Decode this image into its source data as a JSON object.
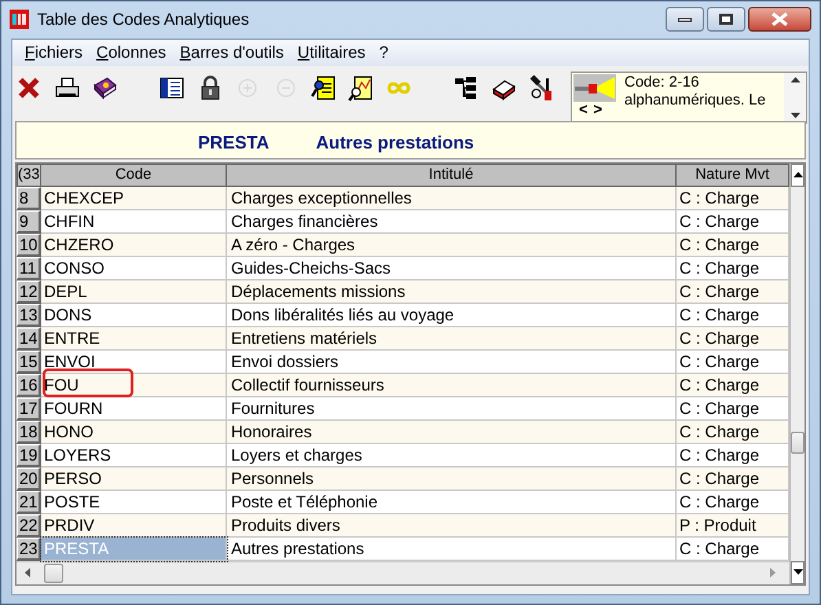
{
  "window": {
    "title": "Table des Codes Analytiques"
  },
  "menu": [
    {
      "label": "Fichiers",
      "underline_first": true
    },
    {
      "label": "Colonnes",
      "underline_first": true
    },
    {
      "label": "Barres d'outils",
      "underline_first": true
    },
    {
      "label": "Utilitaires",
      "underline_first": true
    },
    {
      "label": "?",
      "underline_first": false
    }
  ],
  "toolbar": [
    {
      "kind": "close",
      "disabled": false
    },
    {
      "kind": "print",
      "disabled": false
    },
    {
      "kind": "book",
      "disabled": false
    },
    {
      "kind": "gap"
    },
    {
      "kind": "list",
      "disabled": false
    },
    {
      "kind": "lock",
      "disabled": false
    },
    {
      "kind": "plus",
      "disabled": true
    },
    {
      "kind": "minus",
      "disabled": true
    },
    {
      "kind": "search-doc",
      "disabled": false
    },
    {
      "kind": "search-chart",
      "disabled": false
    },
    {
      "kind": "link",
      "disabled": false
    },
    {
      "kind": "gap"
    },
    {
      "kind": "tree",
      "disabled": false
    },
    {
      "kind": "eraser",
      "disabled": false
    },
    {
      "kind": "tools",
      "disabled": false
    }
  ],
  "info_panel": {
    "lines": [
      "Code: 2-16",
      "alphanumériques. Le"
    ],
    "prev": "<",
    "next": ">"
  },
  "header": {
    "code": "PRESTA",
    "label": "Autres prestations"
  },
  "table": {
    "corner": "(33",
    "columns": [
      "Code",
      "Intitulé",
      "Nature Mvt"
    ],
    "rows": [
      {
        "num": "8",
        "code": "CHEXCEP",
        "label": "Charges exceptionnelles",
        "nature": "C : Charge",
        "selected": false,
        "highlighted": false
      },
      {
        "num": "9",
        "code": "CHFIN",
        "label": "Charges financières",
        "nature": "C : Charge",
        "selected": false,
        "highlighted": false
      },
      {
        "num": "10",
        "code": "CHZERO",
        "label": "A zéro - Charges",
        "nature": "C : Charge",
        "selected": false,
        "highlighted": false
      },
      {
        "num": "11",
        "code": "CONSO",
        "label": "Guides-Cheichs-Sacs",
        "nature": "C : Charge",
        "selected": false,
        "highlighted": false
      },
      {
        "num": "12",
        "code": "DEPL",
        "label": "Déplacements missions",
        "nature": "C : Charge",
        "selected": false,
        "highlighted": false
      },
      {
        "num": "13",
        "code": "DONS",
        "label": "Dons libéralités liés au voyage",
        "nature": "C : Charge",
        "selected": false,
        "highlighted": false
      },
      {
        "num": "14",
        "code": "ENTRE",
        "label": "Entretiens matériels",
        "nature": "C : Charge",
        "selected": false,
        "highlighted": false
      },
      {
        "num": "15",
        "code": "ENVOI",
        "label": "Envoi dossiers",
        "nature": "C : Charge",
        "selected": false,
        "highlighted": false
      },
      {
        "num": "16",
        "code": "FOU",
        "label": "Collectif fournisseurs",
        "nature": "C : Charge",
        "selected": false,
        "highlighted": true
      },
      {
        "num": "17",
        "code": "FOURN",
        "label": "Fournitures",
        "nature": "C : Charge",
        "selected": false,
        "highlighted": false
      },
      {
        "num": "18",
        "code": "HONO",
        "label": "Honoraires",
        "nature": "C : Charge",
        "selected": false,
        "highlighted": false
      },
      {
        "num": "19",
        "code": "LOYERS",
        "label": "Loyers et charges",
        "nature": "C : Charge",
        "selected": false,
        "highlighted": false
      },
      {
        "num": "20",
        "code": "PERSO",
        "label": "Personnels",
        "nature": "C : Charge",
        "selected": false,
        "highlighted": false
      },
      {
        "num": "21",
        "code": "POSTE",
        "label": "Poste et Téléphonie",
        "nature": "C : Charge",
        "selected": false,
        "highlighted": false
      },
      {
        "num": "22",
        "code": "PRDIV",
        "label": "Produits divers",
        "nature": "P : Produit",
        "selected": false,
        "highlighted": false
      },
      {
        "num": "23",
        "code": "PRESTA",
        "label": "Autres prestations",
        "nature": "C : Charge",
        "selected": true,
        "highlighted": false
      }
    ]
  }
}
